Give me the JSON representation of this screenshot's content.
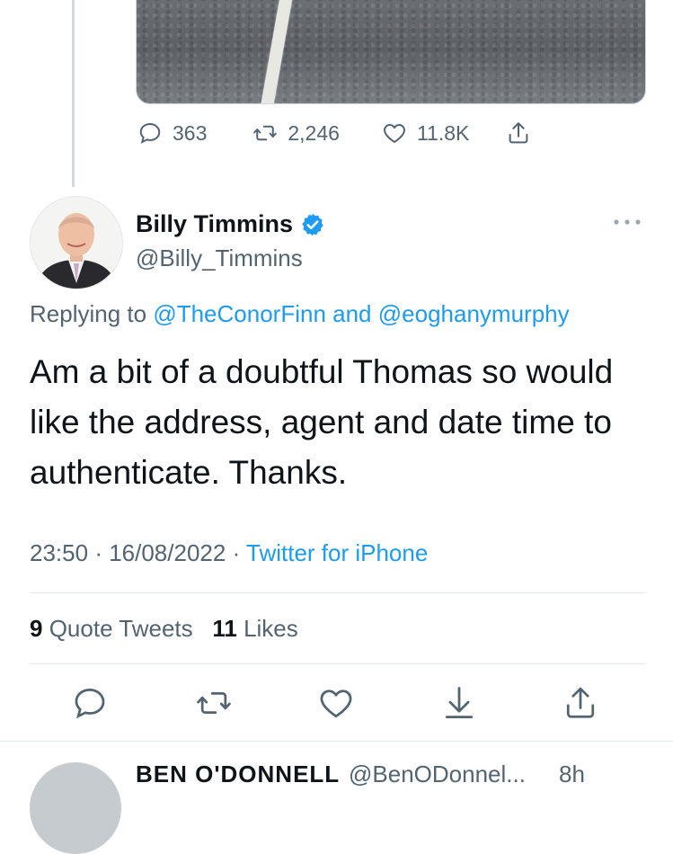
{
  "prev_tweet": {
    "stats": {
      "replies": "363",
      "retweets": "2,246",
      "likes": "11.8K"
    }
  },
  "tweet": {
    "author_name": "Billy Timmins",
    "author_handle": "@Billy_Timmins",
    "replying_prefix": "Replying to",
    "replying_user1": "@TheConorFinn",
    "replying_and": "and",
    "replying_user2": "@eoghanymurphy",
    "text": "Am a bit of a doubtful Thomas so would like the address, agent and date time to authenticate. Thanks.",
    "time": "23:50",
    "date": "16/08/2022",
    "source": "Twitter for iPhone",
    "quote_count": "9",
    "quote_label": "Quote Tweets",
    "like_count": "11",
    "like_label": "Likes"
  },
  "next_reply": {
    "author_name": "BEN O'DONNELL",
    "author_handle": "@BenODonnel...",
    "time": "8h"
  },
  "colors": {
    "link": "#1d9bf0",
    "muted": "#536471",
    "text": "#0f1419",
    "verified": "#1d9bf0"
  }
}
